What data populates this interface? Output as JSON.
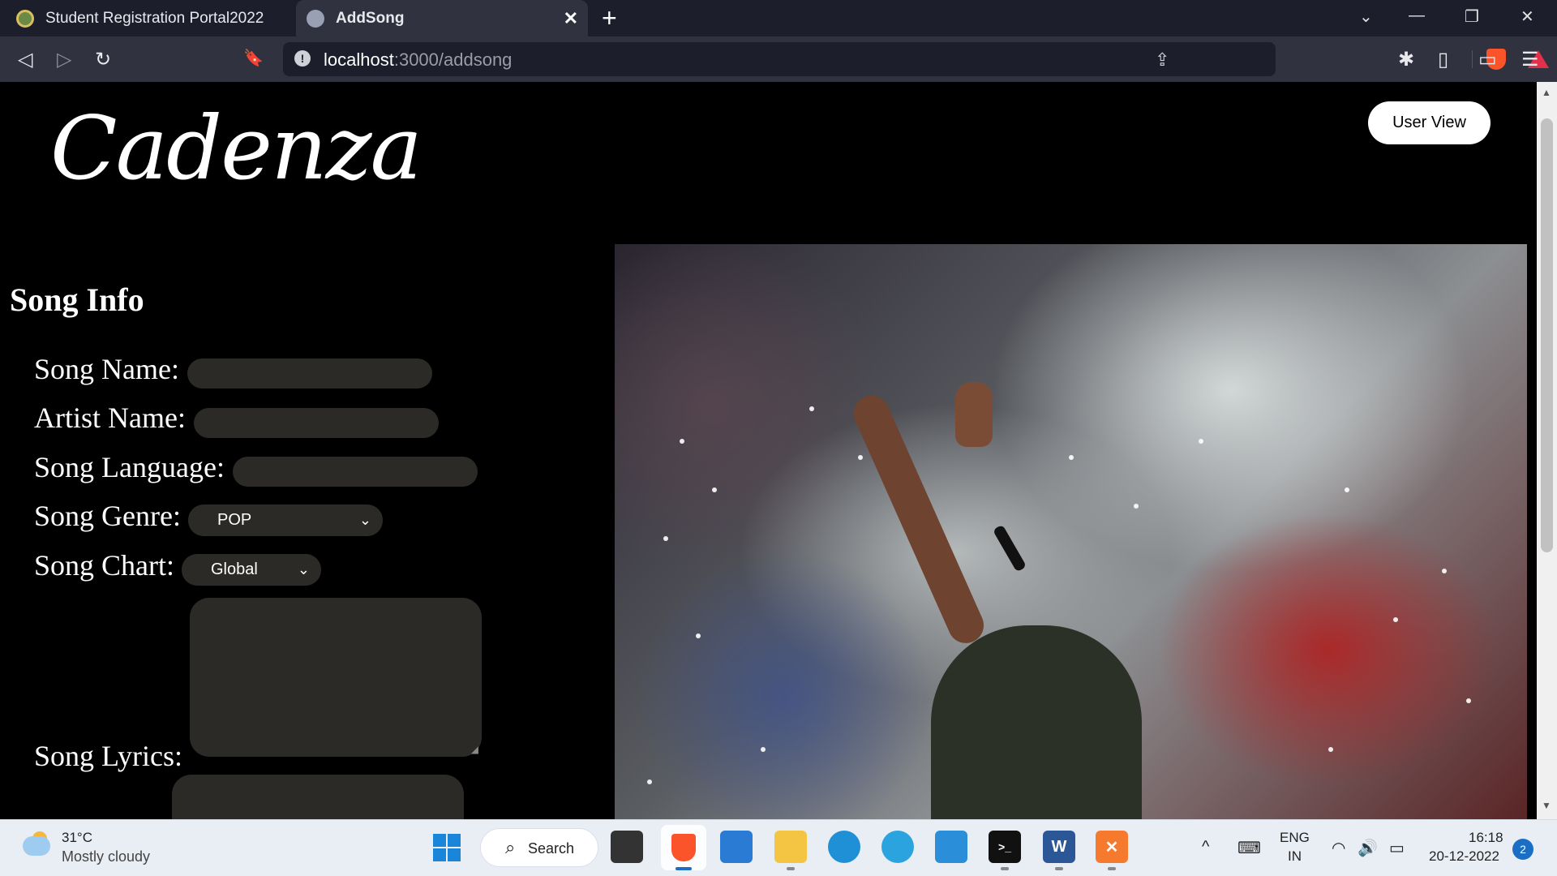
{
  "browser": {
    "tabs": [
      {
        "label": "Student Registration Portal2022",
        "active": false
      },
      {
        "label": "AddSong",
        "active": true
      }
    ],
    "url_host": "localhost",
    "url_path": ":3000/addsong",
    "icons": {
      "back": "◁",
      "forward": "▷",
      "reload": "↻",
      "bookmark": "🔖",
      "info": "!",
      "share": "⇪",
      "extensions": "✱",
      "sidebar": "▯",
      "wallet": "▭",
      "menu": "☰",
      "close_tab": "✕",
      "new_tab": "+",
      "tab_list": "⌄",
      "minimize": "—",
      "restore": "❐",
      "close_window": "✕"
    }
  },
  "page": {
    "logo": "Cadenza",
    "user_view_button": "User View",
    "section_title": "Song Info",
    "labels": {
      "song_name": "Song Name:",
      "artist_name": "Artist Name:",
      "song_language": "Song Language:",
      "song_genre": "Song Genre:",
      "song_chart": "Song Chart:",
      "song_lyrics": "Song Lyrics:"
    },
    "genre_selected": "POP",
    "chart_selected": "Global",
    "chevron": "⌄"
  },
  "taskbar": {
    "weather_temp": "31°C",
    "weather_desc": "Mostly cloudy",
    "search_label": "Search",
    "search_icon": "⌕",
    "lang_top": "ENG",
    "lang_bottom": "IN",
    "time": "16:18",
    "date": "20-12-2022",
    "notifications": "2",
    "tray": {
      "chevron_up": "^",
      "keyboard": "⌨",
      "wifi": "◠",
      "volume": "🔊",
      "battery": "▭"
    },
    "apps": {
      "terminal": ">_",
      "word": "W",
      "xampp": "✕"
    }
  },
  "colors": {
    "tab_bar": "#1c1f2b",
    "toolbar": "#30333f",
    "field_bg": "#2b2a27",
    "accent_blue": "#1a6fc4",
    "brave_orange": "#fb542b"
  }
}
